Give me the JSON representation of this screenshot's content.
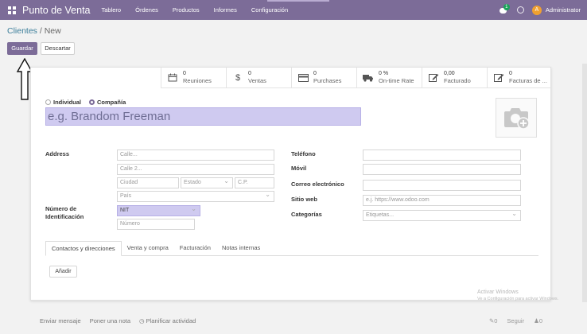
{
  "navbar": {
    "brand": "Punto de Venta",
    "menu": [
      "Tablero",
      "Órdenes",
      "Productos",
      "Informes",
      "Configuración"
    ],
    "chat_badge": "1",
    "user_initial": "A",
    "user_name": "Administrator",
    "color": "#7c6c98"
  },
  "breadcrumb": {
    "parent": "Clientes",
    "current": "New"
  },
  "actions": {
    "save": "Guardar",
    "discard": "Descartar"
  },
  "smart_buttons": [
    {
      "icon": "calendar-icon",
      "value": "0",
      "label": "Reuniones"
    },
    {
      "icon": "dollar-icon",
      "value": "0",
      "label": "Ventas"
    },
    {
      "icon": "card-icon",
      "value": "0",
      "label": "Purchases"
    },
    {
      "icon": "truck-icon",
      "value": "0 %",
      "label": "On-time Rate"
    },
    {
      "icon": "edit-icon",
      "value": "0,00",
      "label": "Facturado"
    },
    {
      "icon": "edit-icon",
      "value": "0",
      "label": "Facturas de ..."
    }
  ],
  "company_type": {
    "individual": "Individual",
    "company": "Compañía",
    "selected": "company"
  },
  "name": {
    "placeholder": "e.g. Brandom Freeman"
  },
  "address": {
    "label": "Address",
    "street": "Calle...",
    "street2": "Calle 2...",
    "city": "Ciudad",
    "state": "Estado",
    "zip": "C.P.",
    "country": "País"
  },
  "vat": {
    "label": "Número de Identificación",
    "type": "NIT",
    "number": "Número"
  },
  "right_fields": {
    "phone": "Teléfono",
    "mobile": "Móvil",
    "email": "Correo electrónico",
    "website": "Sitio web",
    "website_placeholder": "e.j. https://www.odoo.com",
    "tags": "Categorías",
    "tags_placeholder": "Etiquetas..."
  },
  "tabs": [
    "Contactos y direcciones",
    "Venta y compra",
    "Facturación",
    "Notas internas"
  ],
  "add_button": "Añadir",
  "watermark": {
    "line1": "Activar Windows",
    "line2": "Ve a Configuración para activar Windows."
  },
  "chatter": {
    "send": "Enviar mensaje",
    "note": "Poner una nota",
    "activity": "Planificar actividad",
    "attachments": "0",
    "follow": "Seguir",
    "followers": "0"
  }
}
